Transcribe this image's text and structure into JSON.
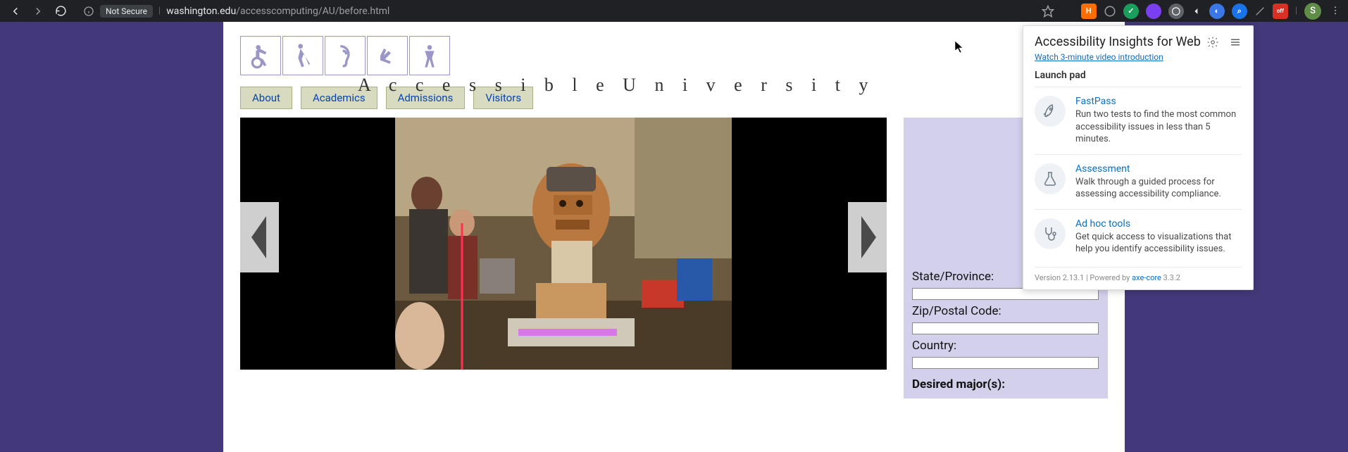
{
  "browser": {
    "security_label": "Not Secure",
    "url_domain": "washington.edu",
    "url_path": "/accesscomputing/AU/before.html",
    "avatar_letter": "S",
    "ext_badges": {
      "orange": "H",
      "red": "off"
    }
  },
  "page": {
    "logo_text": "A c c e s s i b l e   U n i v e r s i t y",
    "nav": [
      "About",
      "Academics",
      "Admissions",
      "Visitors"
    ],
    "form": {
      "state_label": "State/Province:",
      "zip_label": "Zip/Postal Code:",
      "country_label": "Country:",
      "major_label": "Desired major(s):",
      "state_val": "",
      "zip_val": "",
      "country_val": ""
    }
  },
  "panel": {
    "title": "Accessibility Insights for Web",
    "intro_link": "Watch 3-minute video introduction",
    "section": "Launch pad",
    "items": [
      {
        "title": "FastPass",
        "desc": "Run two tests to find the most common accessibility issues in less than 5 minutes."
      },
      {
        "title": "Assessment",
        "desc": "Walk through a guided process for assessing accessibility compliance."
      },
      {
        "title": "Ad hoc tools",
        "desc": "Get quick access to visualizations that help you identify accessibility issues."
      }
    ],
    "footer_pre": "Version 2.13.1 | Powered by ",
    "footer_link": "axe-core",
    "footer_post": " 3.3.2"
  }
}
